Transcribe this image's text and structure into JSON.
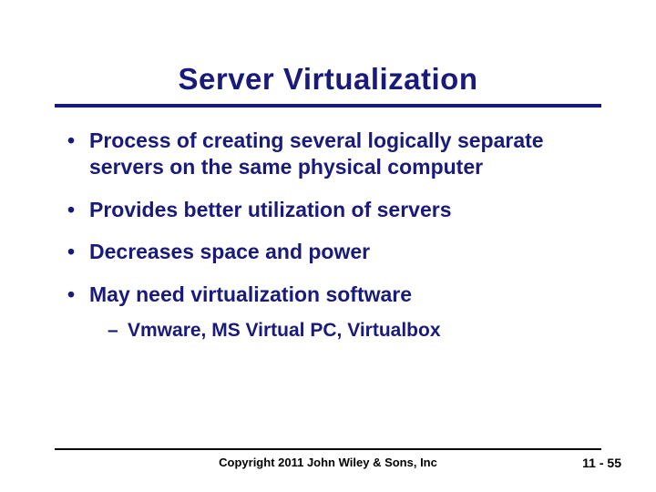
{
  "title": "Server Virtualization",
  "bullets": [
    {
      "text": "Process of creating several logically separate servers on the same physical computer"
    },
    {
      "text": "Provides better utilization of servers"
    },
    {
      "text": "Decreases space and power"
    },
    {
      "text": "May need virtualization software",
      "sub": [
        {
          "text": "Vmware, MS Virtual PC, Virtualbox"
        }
      ]
    }
  ],
  "footer": {
    "copyright": "Copyright 2011 John Wiley & Sons, Inc",
    "page": "11 - 55"
  }
}
